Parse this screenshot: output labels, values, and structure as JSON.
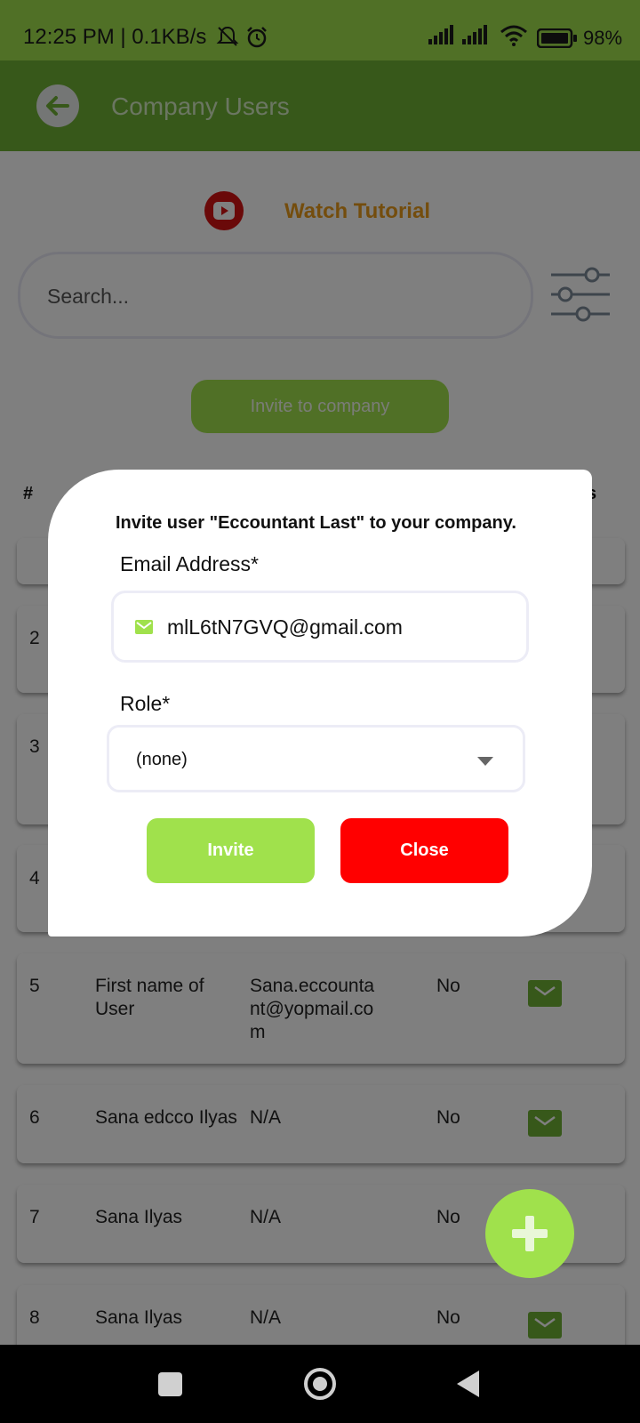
{
  "status_bar": {
    "time_speed": "12:25 PM | 0.1KB/s",
    "battery": "98%",
    "icons": [
      "mute-bell-icon",
      "alarm-icon",
      "signal-icon",
      "signal-icon",
      "wifi-icon",
      "battery-icon"
    ]
  },
  "app_bar": {
    "title": "Company Users",
    "back_icon": "arrow-left-icon"
  },
  "tutorial": {
    "label": "Watch Tutorial",
    "icon": "youtube-icon"
  },
  "search": {
    "placeholder": "Search...",
    "filter_icon": "sliders-icon"
  },
  "invite_company_button": "Invite to company",
  "table": {
    "header_first": "#",
    "header_last_partial": "s",
    "rows": [
      {
        "num": "2",
        "name": "",
        "email": "",
        "flag": ""
      },
      {
        "num": "3",
        "name": "",
        "email": "",
        "flag": ""
      },
      {
        "num": "4",
        "name": "",
        "email": "",
        "flag": ""
      },
      {
        "num": "5",
        "name": "First name of User",
        "email": "Sana.eccountant@yopmail.com",
        "flag": "No"
      },
      {
        "num": "6",
        "name": "Sana edcco Ilyas",
        "email": "N/A",
        "flag": "No"
      },
      {
        "num": "7",
        "name": "Sana Ilyas",
        "email": "N/A",
        "flag": "No"
      },
      {
        "num": "8",
        "name": "Sana Ilyas",
        "email": "N/A",
        "flag": "No"
      }
    ]
  },
  "fab": {
    "icon": "plus-icon"
  },
  "dialog": {
    "title": "Invite user \"Eccountant Last\" to your company.",
    "email_label": "Email Address*",
    "email_value": "mlL6tN7GVQ@gmail.com",
    "role_label": "Role*",
    "role_value": "(none)",
    "invite_button": "Invite",
    "close_button": "Close"
  },
  "colors": {
    "status_bar": "#a0e14c",
    "app_bar": "#6fb135",
    "accent": "#a0e14c",
    "close": "#ff0000",
    "tutorial_text": "#e89a1b"
  }
}
